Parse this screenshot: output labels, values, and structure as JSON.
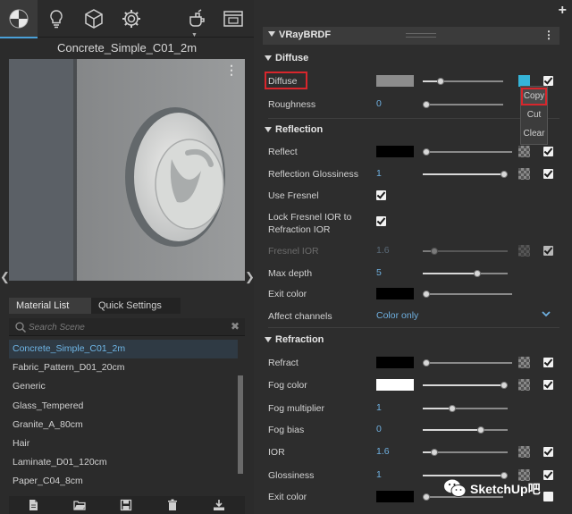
{
  "left_panel": {
    "material_title": "Concrete_Simple_C01_2m",
    "list_tabs": [
      "Material List",
      "Quick Settings"
    ],
    "search_placeholder": "Search Scene",
    "materials": [
      "Concrete_Simple_C01_2m",
      "Fabric_Pattern_D01_20cm",
      "Generic",
      "Glass_Tempered",
      "Granite_A_80cm",
      "Hair",
      "Laminate_D01_120cm",
      "Paper_C04_8cm"
    ],
    "selected_index": 0,
    "list_scroll_fraction": 0.64
  },
  "editor": {
    "header_title": "VRayBRDF",
    "sections": {
      "diffuse": "Diffuse",
      "reflection": "Reflection",
      "refraction": "Refraction"
    },
    "params": {
      "diffuse": {
        "label": "Diffuse",
        "color": "#8c8c8c",
        "slider": 0.2,
        "checked": true
      },
      "roughness": {
        "label": "Roughness",
        "value": "0",
        "slider": 0.0
      },
      "reflect": {
        "label": "Reflect",
        "color": "#000000",
        "slider": 0.0,
        "checked": true
      },
      "reflection_glossiness": {
        "label": "Reflection Glossiness",
        "value": "1",
        "slider": 1.0,
        "checked": true
      },
      "use_fresnel": {
        "label": "Use Fresnel",
        "checked": true
      },
      "lock_fresnel": {
        "label_line1": "Lock Fresnel IOR to",
        "label_line2": "Refraction IOR",
        "checked": true
      },
      "fresnel_ior": {
        "label": "Fresnel IOR",
        "value": "1.6",
        "slider": 0.1,
        "checked": true,
        "disabled": true
      },
      "max_depth": {
        "label": "Max depth",
        "value": "5",
        "slider": 0.65
      },
      "exit_color_reflection": {
        "label": "Exit color",
        "color": "#000000",
        "slider": 0.0
      },
      "affect_channels": {
        "label": "Affect channels",
        "value": "Color only"
      },
      "refract": {
        "label": "Refract",
        "color": "#000000",
        "slider": 0.0,
        "checked": true
      },
      "fog_color": {
        "label": "Fog color",
        "color": "#ffffff",
        "slider": 1.0,
        "checked": true
      },
      "fog_multiplier": {
        "label": "Fog multiplier",
        "value": "1",
        "slider": 0.33
      },
      "fog_bias": {
        "label": "Fog bias",
        "value": "0",
        "slider": 0.7
      },
      "ior": {
        "label": "IOR",
        "value": "1.6",
        "slider": 0.1,
        "checked": true
      },
      "glossiness": {
        "label": "Glossiness",
        "value": "1",
        "slider": 1.0,
        "checked": true
      },
      "exit_color_refraction": {
        "label": "Exit color",
        "color": "#000000",
        "slider": 0.0,
        "checked": false
      }
    },
    "context_menu": [
      "Copy",
      "Cut",
      "Clear"
    ]
  },
  "watermark": {
    "text": "SketchUp吧"
  },
  "colors": {
    "accent": "#4aa0d8",
    "highlight": "#d8262c",
    "map_active": "#35b4d8"
  }
}
